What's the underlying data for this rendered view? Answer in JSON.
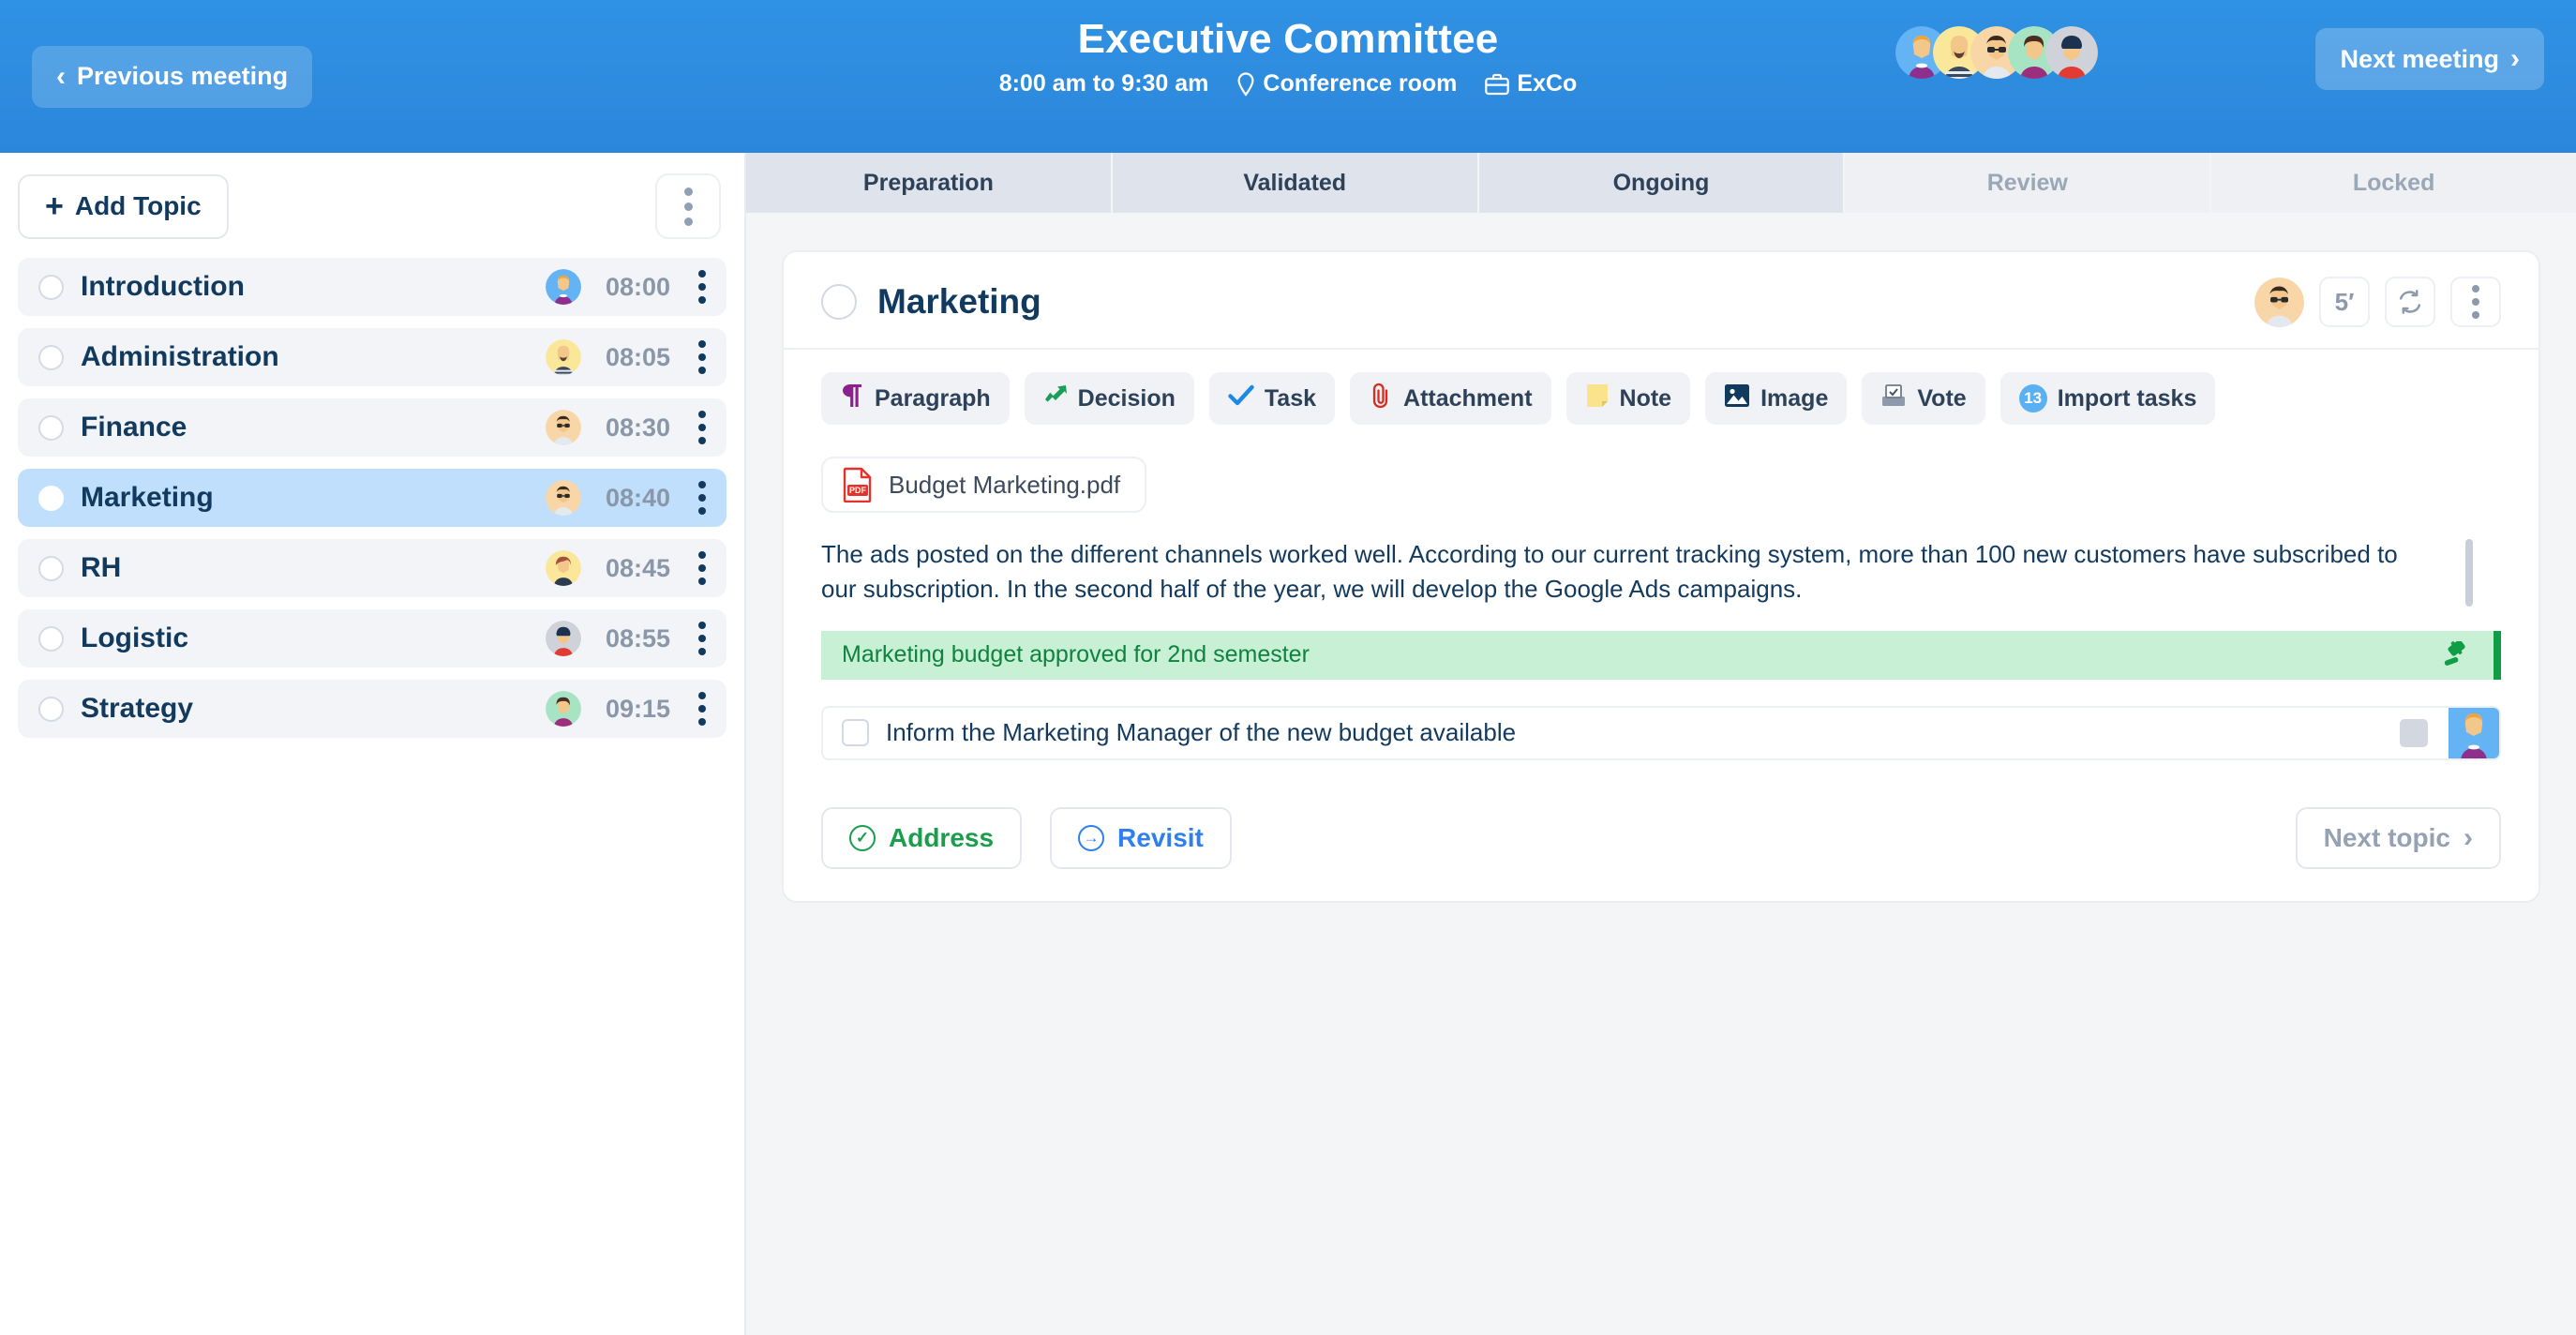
{
  "header": {
    "prev_label": "Previous meeting",
    "next_label": "Next meeting",
    "title": "Executive Committee",
    "time_range": "8:00 am to 9:30 am",
    "location": "Conference room",
    "group": "ExCo",
    "prev_chevron": "‹",
    "next_chevron": "›",
    "pin_icon": "location-pin-icon",
    "briefcase_icon": "briefcase-icon",
    "participant_count": 5,
    "brand_color": "#2f8de0"
  },
  "sidebar": {
    "add_topic_label": "Add Topic",
    "plus": "+",
    "topics": [
      {
        "name": "Introduction",
        "time": "08:00",
        "selected": false
      },
      {
        "name": "Administration",
        "time": "08:05",
        "selected": false
      },
      {
        "name": "Finance",
        "time": "08:30",
        "selected": false
      },
      {
        "name": "Marketing",
        "time": "08:40",
        "selected": true
      },
      {
        "name": "RH",
        "time": "08:45",
        "selected": false
      },
      {
        "name": "Logistic",
        "time": "08:55",
        "selected": false
      },
      {
        "name": "Strategy",
        "time": "09:15",
        "selected": false
      }
    ]
  },
  "tabs": [
    {
      "label": "Preparation",
      "state": "done"
    },
    {
      "label": "Validated",
      "state": "done"
    },
    {
      "label": "Ongoing",
      "state": "done"
    },
    {
      "label": "Review",
      "state": "pending"
    },
    {
      "label": "Locked",
      "state": "pending"
    }
  ],
  "card": {
    "title": "Marketing",
    "duration": "5′",
    "refresh_icon": "refresh-icon",
    "kebab_icon": "more-vertical-icon",
    "toolbar": [
      {
        "label": "Paragraph",
        "icon": "paragraph-icon"
      },
      {
        "label": "Decision",
        "icon": "decision-arrow-icon"
      },
      {
        "label": "Task",
        "icon": "check-icon"
      },
      {
        "label": "Attachment",
        "icon": "paperclip-icon"
      },
      {
        "label": "Note",
        "icon": "sticky-note-icon"
      },
      {
        "label": "Image",
        "icon": "image-icon"
      },
      {
        "label": "Vote",
        "icon": "ballot-box-icon"
      },
      {
        "label": "Import tasks",
        "icon": "import-badge-icon",
        "badge": "13"
      }
    ],
    "attachment": {
      "name": "Budget Marketing.pdf",
      "icon": "pdf-file-icon"
    },
    "paragraph": "The ads posted on the different channels worked well. According to our current tracking system, more than 100 new customers have subscribed to our subscription. In the second half of the year, we will develop the Google Ads campaigns.",
    "decision": {
      "text": "Marketing budget approved for 2nd semester",
      "icon": "gavel-icon",
      "bg": "#c8f0d5",
      "accent": "#0f9d46"
    },
    "task": {
      "text": "Inform the Marketing Manager of the new budget available",
      "checked": false
    },
    "footer": {
      "address_label": "Address",
      "revisit_label": "Revisit",
      "next_topic_label": "Next topic",
      "next_chevron": "›"
    }
  }
}
